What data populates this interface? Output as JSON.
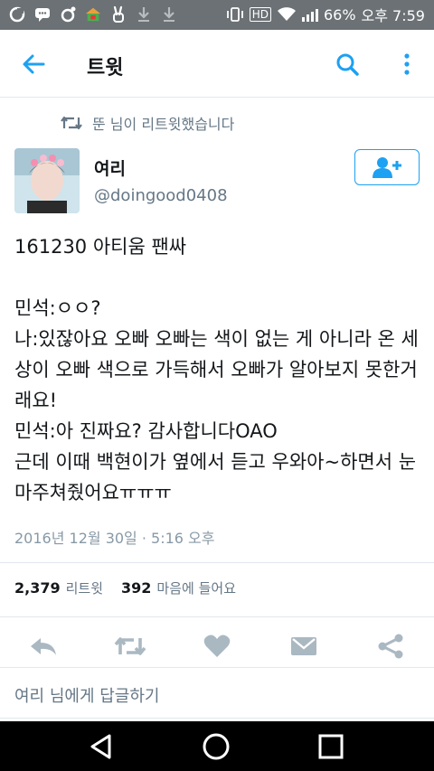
{
  "status_bar": {
    "battery": "66%",
    "time": "오후 7:59",
    "hd": "HD"
  },
  "app_bar": {
    "title": "트윗"
  },
  "retweet_context": "뚠 님이 리트윗했습니다",
  "tweet": {
    "author_name": "여리",
    "author_handle": "@doingood0408",
    "text": "161230 아티움 팬싸\n\n민석:ㅇㅇ?\n나:있잖아요 오빠 오빠는 색이 없는 게 아니라 온 세상이 오빠 색으로 가득해서 오빠가 알아보지 못한거래요!\n민석:아 진짜요? 감사합니다OAO\n근데 이때 백현이가 옆에서 듣고 우와아~하면서 눈 마주쳐줬어요ㅠㅠㅠ",
    "timestamp": "2016년 12월 30일 · 5:16 오후",
    "retweet_count": "2,379",
    "retweet_label": "리트윗",
    "like_count": "392",
    "like_label": "마음에 들어요"
  },
  "reply_placeholder": "여리 님에게 답글하기",
  "colors": {
    "accent": "#1da1f2",
    "icon_gray": "#aab8c2",
    "text_secondary": "#657786"
  },
  "icons": [
    "back-arrow-icon",
    "search-icon",
    "more-vertical-icon",
    "retweet-icon",
    "add-user-icon",
    "reply-icon",
    "like-icon",
    "direct-message-icon",
    "share-icon",
    "nav-back-icon",
    "nav-home-icon",
    "nav-recents-icon"
  ]
}
